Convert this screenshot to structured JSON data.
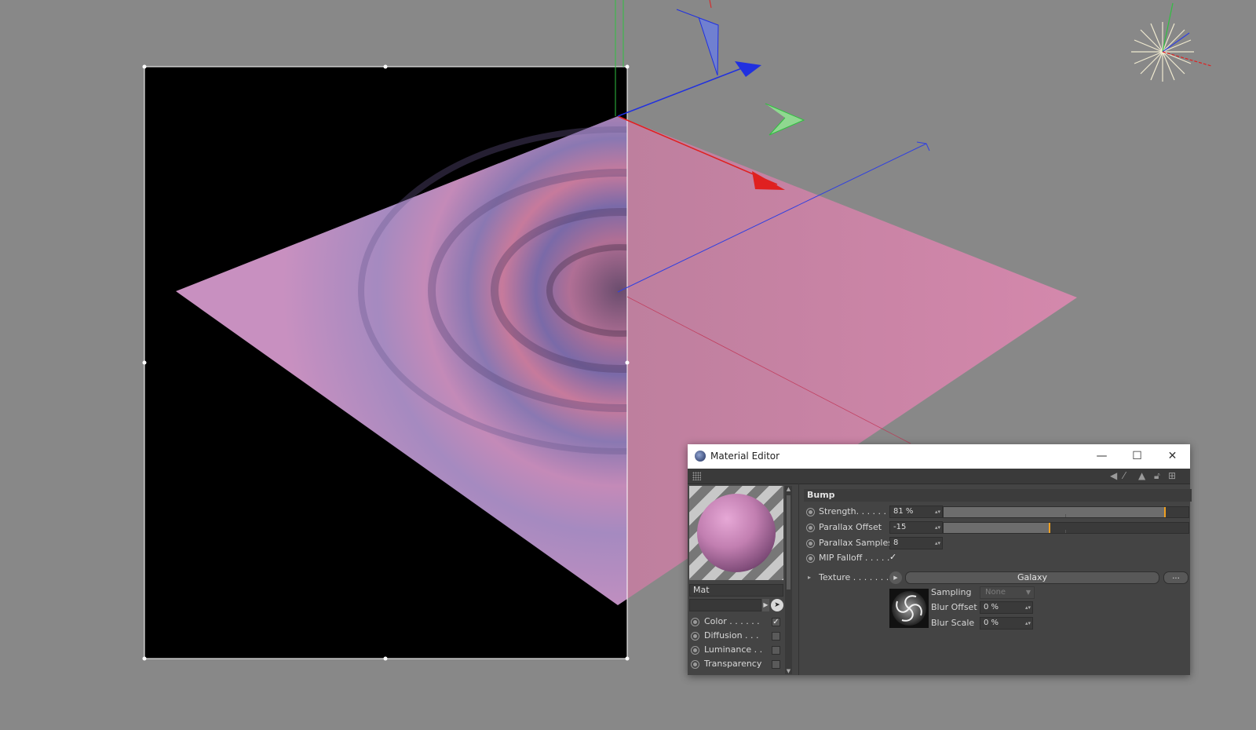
{
  "window": {
    "title": "Material Editor",
    "minimize_icon": "minimize-icon",
    "maximize_icon": "maximize-icon",
    "close_icon": "close-icon"
  },
  "material": {
    "name": "Mat",
    "channels": [
      {
        "label": "Color . . . . . .",
        "checked": true
      },
      {
        "label": "Diffusion . . .",
        "checked": false
      },
      {
        "label": "Luminance . .",
        "checked": false
      },
      {
        "label": "Transparency",
        "checked": false
      }
    ]
  },
  "bump": {
    "section_title": "Bump",
    "strength": {
      "label": "Strength. . . . . . .",
      "value": "81 %",
      "fraction": 0.9
    },
    "parallax_offset": {
      "label": "Parallax Offset",
      "value": "-15",
      "fraction": 0.43
    },
    "parallax_samples": {
      "label": "Parallax Samples",
      "value": "8"
    },
    "mip_falloff": {
      "label": "MIP Falloff . . . . .",
      "checked": true,
      "check_glyph": "✓"
    },
    "texture": {
      "label": "Texture . . . . . . . .",
      "name": "Galaxy",
      "more_label": "...",
      "sampling_label": "Sampling",
      "sampling_value": "None",
      "blur_offset_label": "Blur Offset",
      "blur_offset_value": "0 %",
      "blur_scale_label": "Blur Scale",
      "blur_scale_value": "0 %"
    }
  },
  "colors": {
    "viewport_bg": "#888888",
    "plane_pink": "#c880ac",
    "accent_orange": "#f0a020",
    "axis_red": "#e02020",
    "axis_green": "#30c040",
    "axis_blue": "#2030e0"
  }
}
